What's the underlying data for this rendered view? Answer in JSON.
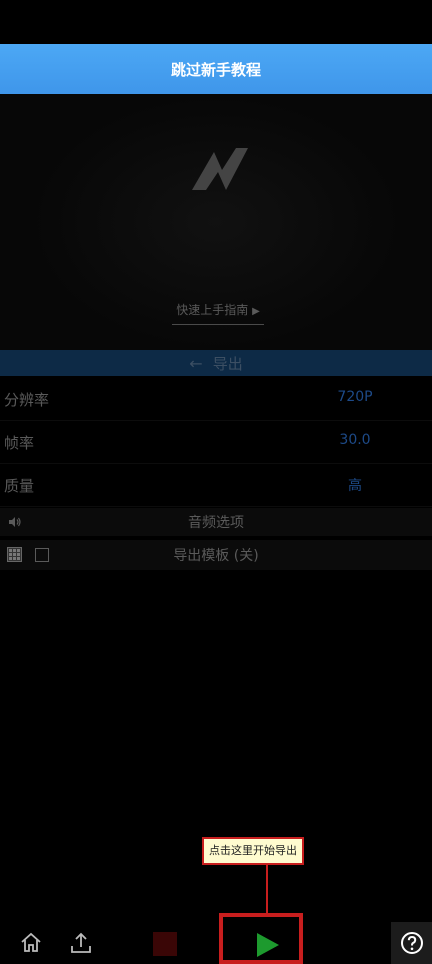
{
  "header": {
    "skip_tutorial_label": "跳过新手教程"
  },
  "preview": {
    "guide_label": "快速上手指南",
    "guide_arrow": "▶"
  },
  "export_panel": {
    "title": "导出",
    "back_arrow": "←",
    "rows": [
      {
        "label": "分辨率",
        "value": "720P"
      },
      {
        "label": "帧率",
        "value": "30.0"
      },
      {
        "label": "质量",
        "value": "高"
      }
    ],
    "audio_options_label": "音频选项",
    "export_template_label": "导出模板 (关)"
  },
  "tutorial": {
    "tooltip_text": "点击这里开始导出"
  },
  "colors": {
    "accent_blue": "#4ca8f5",
    "value_blue": "#1d4a88",
    "play_green": "#1d9a2e",
    "highlight_red": "#c81e1e"
  },
  "icons": {
    "home": "home-icon",
    "share": "share-icon",
    "stop": "stop-icon",
    "play": "play-icon",
    "help": "help-icon",
    "speaker": "speaker-icon",
    "template": "template-icon"
  }
}
